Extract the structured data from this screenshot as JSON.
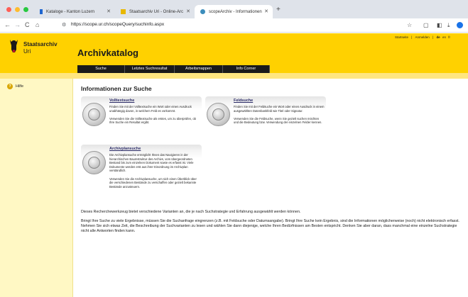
{
  "browser": {
    "tabs": [
      {
        "title": "Kataloge - Kanton Luzern",
        "icon": "luzern-icon",
        "color": "#1e66d0"
      },
      {
        "title": "Staatsarchiv Uri - Online-Arc",
        "icon": "uri-icon",
        "color": "#e8b800"
      },
      {
        "title": "scopeArchiv - Informationen",
        "icon": "scope-icon",
        "color": "#3c8dbc"
      }
    ],
    "url": "https://scope.ur.ch/scopeQuery/suchinfo.aspx",
    "colors": {
      "close": "#ff5f57",
      "minimize": "#febc2e",
      "maximize": "#28c840"
    }
  },
  "header": {
    "brand_line1": "Staatsarchiv",
    "brand_line2": "Uri",
    "title": "Archivkatalog",
    "links": {
      "start": "Startseite",
      "sep1": "|",
      "login": "Anmelden",
      "sep2": "|",
      "de": "de",
      "en": "en",
      "fr": "fr"
    },
    "menu": [
      "Suche",
      "Letztes Suchresultat",
      "Arbeitsmappen",
      "Info Corner"
    ],
    "accent": "#ffd100"
  },
  "sidebar": {
    "help": "Hilfe"
  },
  "main": {
    "heading": "Informationen zur Suche",
    "cards": [
      {
        "title": "Volltextsuche",
        "text1": "Finden Sie mit der Volltextsuche ein Wort oder einen Ausdruck unabhängig davon, in welchem Feld es vorkommt.",
        "text2": "Verwenden Sie die Volltextsuche als erstes, um zu überprüfen, ob Ihre Suche ein Resultat ergibt."
      },
      {
        "title": "Feldsuche",
        "text1": "Finden Sie mit der Feldsuche ein Wort oder einen Ausdruck in einem ausgewählten Datenbankfeld wie Titel oder Signatur.",
        "text2": "Verwenden Sie die Feldsuche, wenn Sie gezielt suchen möchten und die Bedeutung bzw. Verwendung der einzelnen Felder kennen."
      },
      {
        "title": "Archivplansuche",
        "text1": "Die Archivplansuche ermöglicht Ihnen das Navigieren in der hierarchischen Baumstruktur des Archivs, vom übergeordneten Bestand bis zum einzelnen Dokument sowie es erfasst ist. Viele Dokumente werden erst aus ihrer Einordnung im Archivplan verständlich.",
        "text2": "Verwenden Sie die Archivplansuche, um sich einen Überblick über die verschiedenen Bestände zu verschaffen oder gezielt bekannte Bestände anzusteuern."
      }
    ],
    "para1": "Dieses Recherchewerkzeug bietet verschiedene Varianten an, die je nach Suchstrategie und Erfahrung ausgewählt werden können.",
    "para2": "Bringt Ihre Suche zu viele Ergebnisse, müssen Sie die Suchanfrage eingrenzen (z.B. mit Feldsuche oder Datumsangabe). Bringt Ihre Suche kein Ergebnis, sind die Informationen möglicherweise (noch) nicht elektronisch erfasst. Nehmen Sie sich etwas Zeit, die Beschreibung der Suchvarianten zu lesen und wählen Sie dann diejenige, welche Ihren Bedürfnissen am Besten entspricht. Denken Sie aber daran, dass manchmal eine einzelne Suchstrategie nicht alle Antworten finden kann."
  }
}
